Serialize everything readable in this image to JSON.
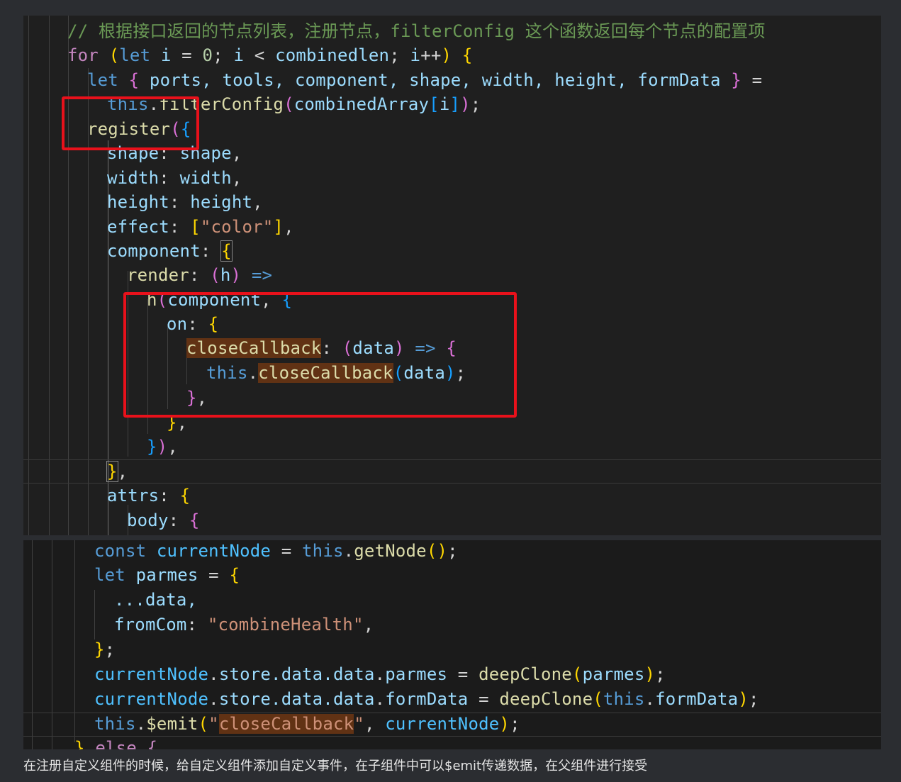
{
  "code_top": {
    "comment": "// 根据接口返回的节点列表，注册节点，filterConfig 这个函数返回每个节点的配置项",
    "for_kw": "for",
    "let_kw": "let",
    "var_i": "i",
    "zero": "0",
    "combinedlen": "combinedlen",
    "destructure_vars": "ports, tools, component, shape, width, height, formData",
    "this_kw": "this",
    "filterConfig": "filterConfig",
    "combinedArray": "combinedArray",
    "register": "register",
    "shape_key": "shape",
    "width_key": "width",
    "height_key": "height",
    "effect_key": "effect",
    "color_str": "\"color\"",
    "component_key": "component",
    "render_key": "render",
    "h_param": "h",
    "h_fn": "h",
    "on_key": "on",
    "closeCallback": "closeCallback",
    "data_param": "data",
    "attrs_key": "attrs",
    "body_key": "body"
  },
  "code_bottom": {
    "const_kw": "const",
    "currentNode": "currentNode",
    "this_kw": "this",
    "getNode": "getNode",
    "let_kw": "let",
    "parmes": "parmes",
    "spread_data": "...data,",
    "fromCom": "fromCom",
    "combineHealth_str": "\"combineHealth\"",
    "store_path": "store.data.data",
    "parmes_key": "parmes",
    "formData_key": "formData",
    "deepClone": "deepClone",
    "emit": "$emit",
    "closeCallback_str": "closeCallback",
    "else_partial": "else {"
  },
  "caption": "在注册自定义组件的时候，给自定义组件添加自定义事件，在子组件中可以$emit传递数据，在父组件进行接受",
  "colors": {
    "page_bg": "#2b2d31",
    "editor_bg": "#1f1f1f",
    "highlight_box": "#e8111b",
    "keyword": "#569cd6",
    "control": "#c586c0",
    "variable": "#9cdcfe",
    "function": "#dcdcaa",
    "string": "#ce9178",
    "comment": "#6a9955"
  }
}
